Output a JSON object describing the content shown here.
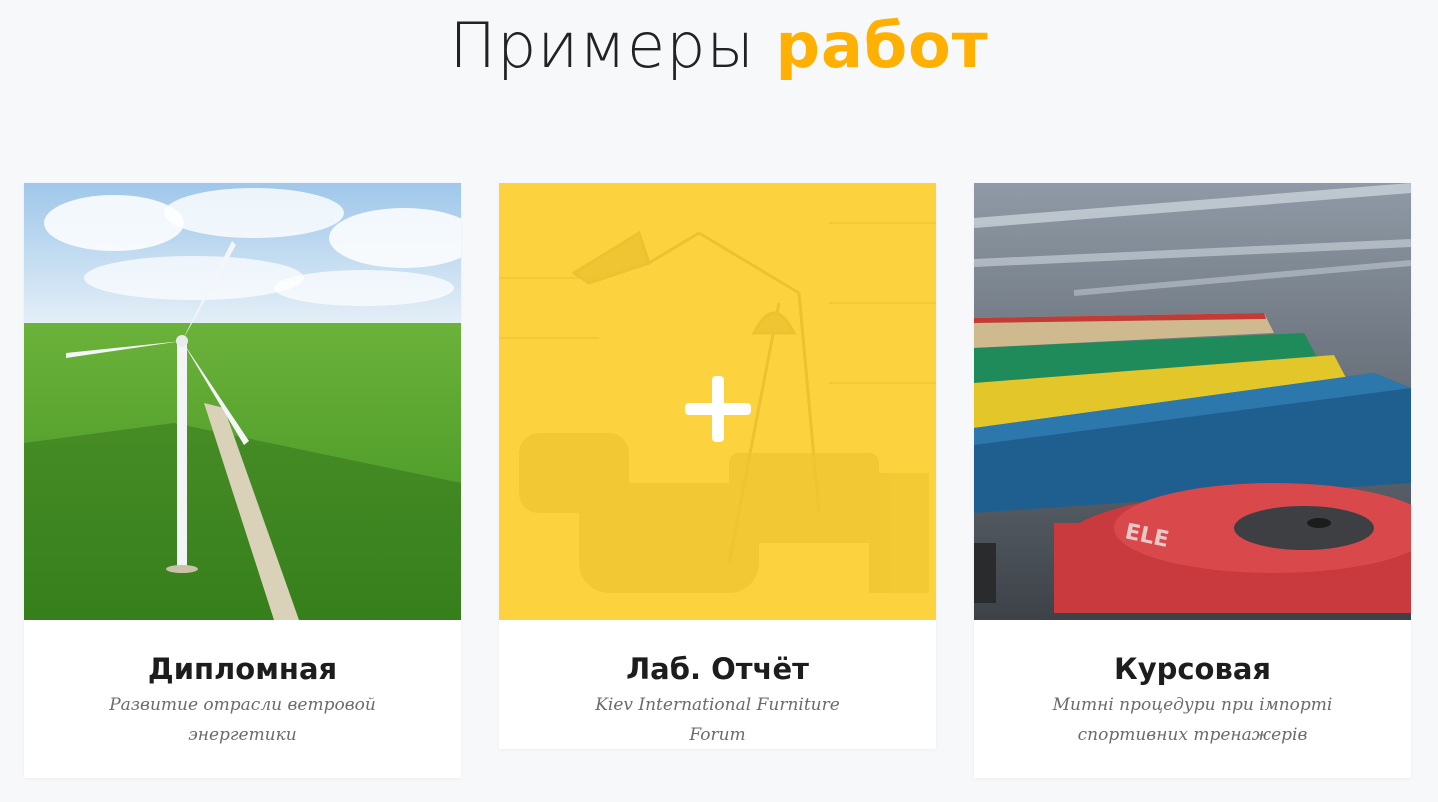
{
  "section": {
    "title_light": "Примеры ",
    "title_accent": "работ"
  },
  "colors": {
    "accent": "#ffb000",
    "overlay_yellow": "#fcd33e",
    "background": "#f7f8fa"
  },
  "cards": [
    {
      "title": "Дипломная",
      "subtitle": "Развитие отрасли ветровой энергетики",
      "image": "wind-turbine-field"
    },
    {
      "title": "Лаб. Отчёт",
      "subtitle": "Kiev International Furniture Forum",
      "image": "furniture-interior",
      "overlay_icon": "plus-icon"
    },
    {
      "title": "Курсовая",
      "subtitle": "Митні процедури при імпорті спортивних тренажерів",
      "image": "weight-plates"
    }
  ]
}
